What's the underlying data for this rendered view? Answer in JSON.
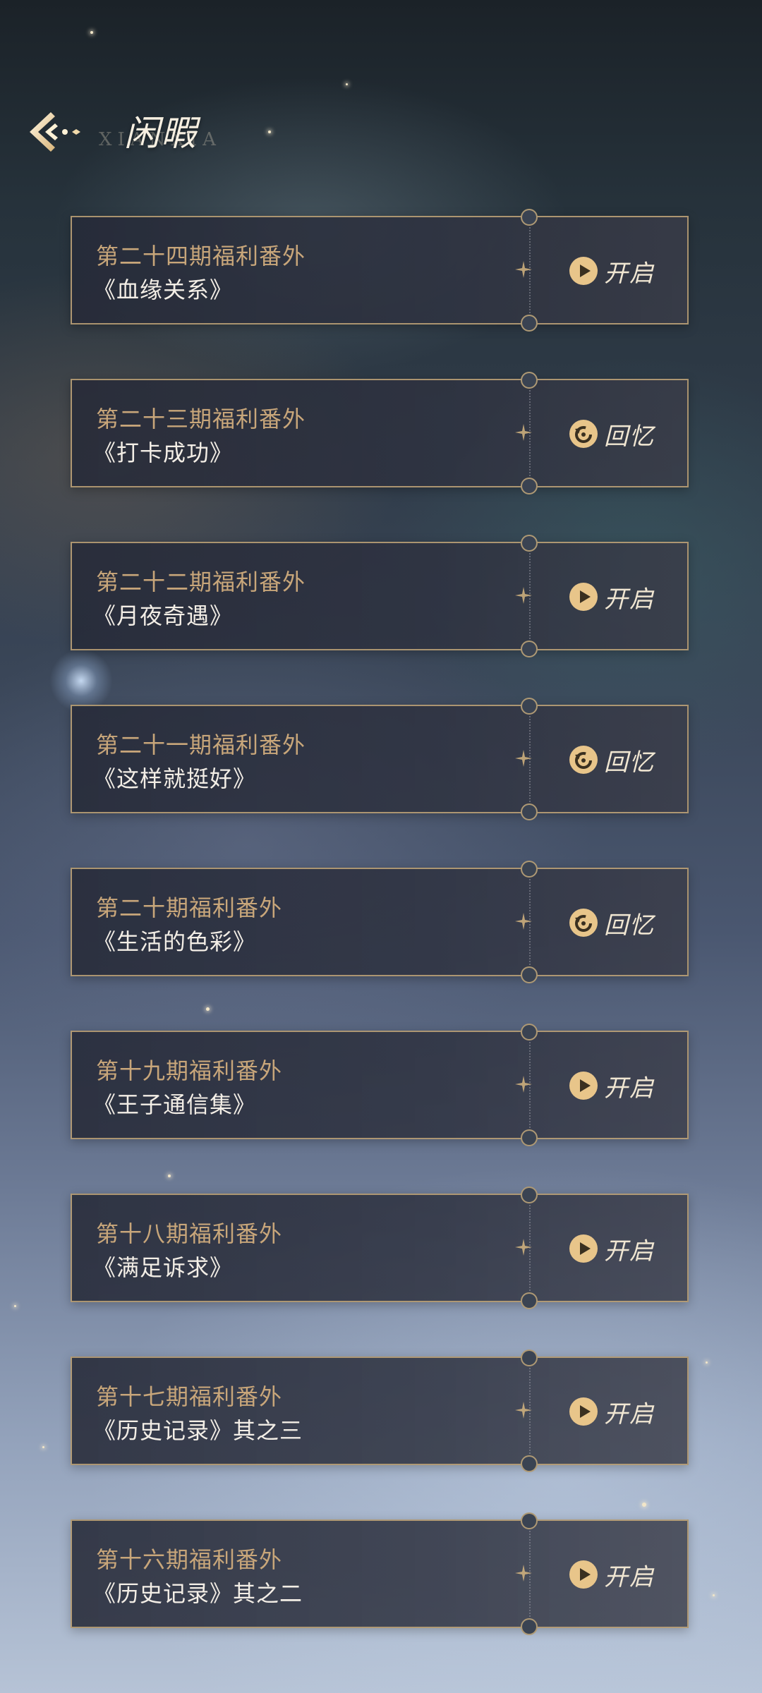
{
  "header": {
    "title": "闲暇",
    "subtitle": "XIANXIA"
  },
  "colors": {
    "gold": "#c8a67a",
    "card_border": "#d6b680",
    "icon_fill": "#e8c58a"
  },
  "items": [
    {
      "period": "第二十四期福利番外",
      "title": "《血缘关系》",
      "action": "开启",
      "icon": "play-icon"
    },
    {
      "period": "第二十三期福利番外",
      "title": "《打卡成功》",
      "action": "回忆",
      "icon": "replay-icon"
    },
    {
      "period": "第二十二期福利番外",
      "title": "《月夜奇遇》",
      "action": "开启",
      "icon": "play-icon"
    },
    {
      "period": "第二十一期福利番外",
      "title": "《这样就挺好》",
      "action": "回忆",
      "icon": "replay-icon"
    },
    {
      "period": "第二十期福利番外",
      "title": "《生活的色彩》",
      "action": "回忆",
      "icon": "replay-icon"
    },
    {
      "period": "第十九期福利番外",
      "title": "《王子通信集》",
      "action": "开启",
      "icon": "play-icon"
    },
    {
      "period": "第十八期福利番外",
      "title": "《满足诉求》",
      "action": "开启",
      "icon": "play-icon"
    },
    {
      "period": "第十七期福利番外",
      "title": "《历史记录》其之三",
      "action": "开启",
      "icon": "play-icon"
    },
    {
      "period": "第十六期福利番外",
      "title": "《历史记录》其之二",
      "action": "开启",
      "icon": "play-icon"
    }
  ]
}
